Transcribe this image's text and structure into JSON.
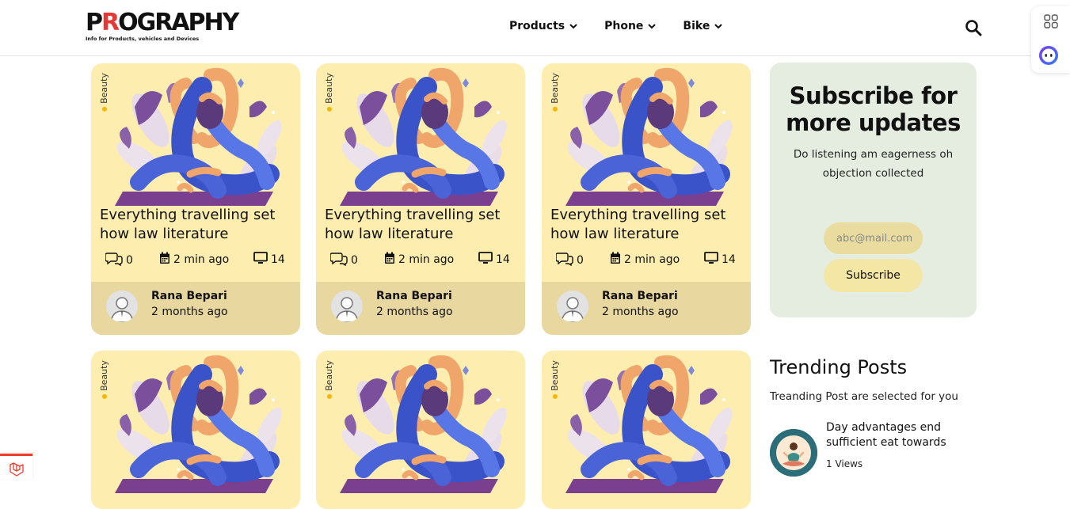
{
  "header": {
    "logo_text": "PROGRAPHY",
    "logo_tagline": "Info for Products, vehicles and Devices",
    "nav": [
      {
        "label": "Products"
      },
      {
        "label": "Phone"
      },
      {
        "label": "Bike"
      }
    ]
  },
  "cards": [
    {
      "category": "Beauty",
      "title": "Everything travelling set how law literature",
      "comments": "0",
      "time": "2 min ago",
      "views": "14",
      "author": "Rana Bepari",
      "posted": "2 months ago"
    },
    {
      "category": "Beauty",
      "title": "Everything travelling set how law literature",
      "comments": "0",
      "time": "2 min ago",
      "views": "14",
      "author": "Rana Bepari",
      "posted": "2 months ago"
    },
    {
      "category": "Beauty",
      "title": "Everything travelling set how law literature",
      "comments": "0",
      "time": "2 min ago",
      "views": "14",
      "author": "Rana Bepari",
      "posted": "2 months ago"
    },
    {
      "category": "Beauty"
    },
    {
      "category": "Beauty"
    },
    {
      "category": "Beauty"
    }
  ],
  "subscribe": {
    "title": "Subscribe for more updates",
    "description": "Do listening am eagerness oh objection collected",
    "email_value": "abc@mail.com",
    "button_label": "Subscribe"
  },
  "trending": {
    "title": "Trending Posts",
    "subtitle": "Treanding Post are selected for you",
    "items": [
      {
        "title": "Day advantages end sufficient eat towards",
        "views": "1 Views"
      }
    ]
  },
  "colors": {
    "card_bg": "#fdeeb0",
    "author_bar": "#e8d79f",
    "subscribe_bg": "#e4ede0",
    "accent_red": "#e53935",
    "category_dot": "#f5b800"
  }
}
